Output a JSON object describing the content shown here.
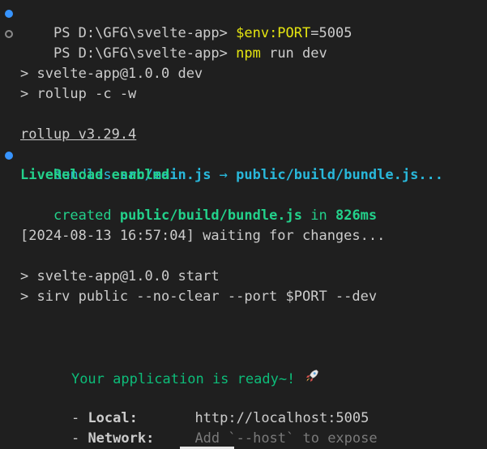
{
  "colors": {
    "background": "#1f1f1f",
    "text": "#cccccc",
    "yellow": "#e5e510",
    "cyan": "#29b8db",
    "green": "#23d18b",
    "dark_green": "#0dbc79",
    "gray": "#7a7a7a",
    "dot_blue": "#3794ff"
  },
  "lines": {
    "l1": {
      "prompt": "PS D:\\GFG\\svelte-app> ",
      "cmd": "$env:PORT",
      "rest": "=5005"
    },
    "l2": {
      "prompt": "PS D:\\GFG\\svelte-app> ",
      "cmd": "npm",
      "rest": " run dev"
    },
    "l3": "> svelte-app@1.0.0 dev",
    "l4": "> rollup -c -w",
    "l5": "rollup v3.29.4",
    "l6": {
      "bundles": "bundles ",
      "src": "src/main.js",
      "arrow": " → ",
      "dest": "public/build/bundle.js..."
    },
    "l7": "LiveReload enabled",
    "l8": {
      "created": "created ",
      "file": "public/build/bundle.js",
      "in": " in ",
      "time": "826ms"
    },
    "l9": "[2024-08-13 16:57:04] waiting for changes...",
    "l10": "> svelte-app@1.0.0 start",
    "l11": "> sirv public --no-clear --port $PORT --dev",
    "l12": {
      "text": "Your application is ready~! ",
      "icon": "rocket-icon"
    },
    "l13": {
      "bullet": "- ",
      "label": "Local:",
      "value": "http://localhost:5005"
    },
    "l14": {
      "bullet": "- ",
      "label": "Network:",
      "value": "Add `--host` to expose"
    }
  }
}
